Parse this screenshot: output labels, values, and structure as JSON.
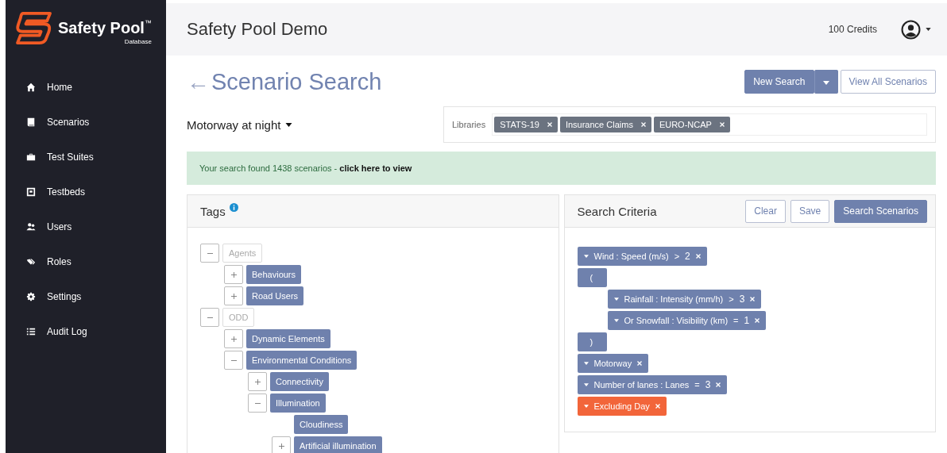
{
  "brand": {
    "name": "Safety Pool",
    "trademark": "™",
    "subtitle": "Database"
  },
  "sidebar": {
    "items": [
      {
        "label": "Home",
        "selected": false
      },
      {
        "label": "Scenarios",
        "selected": false
      },
      {
        "label": "Test Suites",
        "selected": false
      },
      {
        "label": "Testbeds",
        "selected": false
      },
      {
        "label": "Users",
        "selected": false
      },
      {
        "label": "Roles",
        "selected": false
      },
      {
        "label": "Settings",
        "selected": false
      },
      {
        "label": "Audit Log",
        "selected": false
      }
    ]
  },
  "header": {
    "title": "Safety Pool Demo",
    "credits": "100 Credits"
  },
  "page": {
    "back": "←",
    "title": "Scenario Search"
  },
  "buttons": {
    "new_search": "New Search",
    "view_all": "View All Scenarios"
  },
  "preset": "Motorway at night",
  "libraries": {
    "label": "Libraries",
    "tags": [
      "STATS-19",
      "Insurance Claims",
      "EURO-NCAP"
    ]
  },
  "alert": {
    "text": "Your search found 1438 scenarios - ",
    "link": "click here to view"
  },
  "tags_panel": {
    "title": "Tags",
    "tree": [
      {
        "label": "Agents",
        "kind": "group",
        "expanded": true,
        "children": [
          {
            "label": "Behaviours",
            "kind": "tag",
            "expanded": false
          },
          {
            "label": "Road Users",
            "kind": "tag",
            "expanded": false
          }
        ]
      },
      {
        "label": "ODD",
        "kind": "group",
        "expanded": true,
        "children": [
          {
            "label": "Dynamic Elements",
            "kind": "tag",
            "expanded": false
          },
          {
            "label": "Environmental Conditions",
            "kind": "tag",
            "expanded": true,
            "children": [
              {
                "label": "Connectivity",
                "kind": "tag",
                "expanded": false
              },
              {
                "label": "Illumination",
                "kind": "tag",
                "expanded": true,
                "children": [
                  {
                    "label": "Cloudiness",
                    "kind": "leaf"
                  },
                  {
                    "label": "Artificial illumination",
                    "kind": "tag",
                    "expanded": false
                  }
                ]
              }
            ]
          }
        ]
      }
    ]
  },
  "criteria_panel": {
    "title": "Search Criteria",
    "buttons": [
      "Clear",
      "Save"
    ],
    "primary": "Search Scenarios",
    "criteria": [
      {
        "kind": "criterion",
        "text": "Wind : Speed (m/s)",
        "op": ">",
        "value": "2",
        "excluded": false
      },
      {
        "kind": "group",
        "open": "(",
        "close": ")",
        "children": [
          {
            "kind": "criterion",
            "text": "Rainfall : Intensity (mm/h)",
            "op": ">",
            "value": "3",
            "excluded": false
          },
          {
            "kind": "criterion",
            "text": "Or Snowfall : Visibility (km)",
            "op": "=",
            "value": "1",
            "excluded": false
          }
        ]
      },
      {
        "kind": "criterion",
        "text": "Motorway",
        "excluded": false
      },
      {
        "kind": "criterion",
        "text": "Number of lanes : Lanes",
        "op": "=",
        "value": "3",
        "excluded": false
      },
      {
        "kind": "criterion",
        "text": "Excluding Day",
        "excluded": true
      }
    ]
  }
}
